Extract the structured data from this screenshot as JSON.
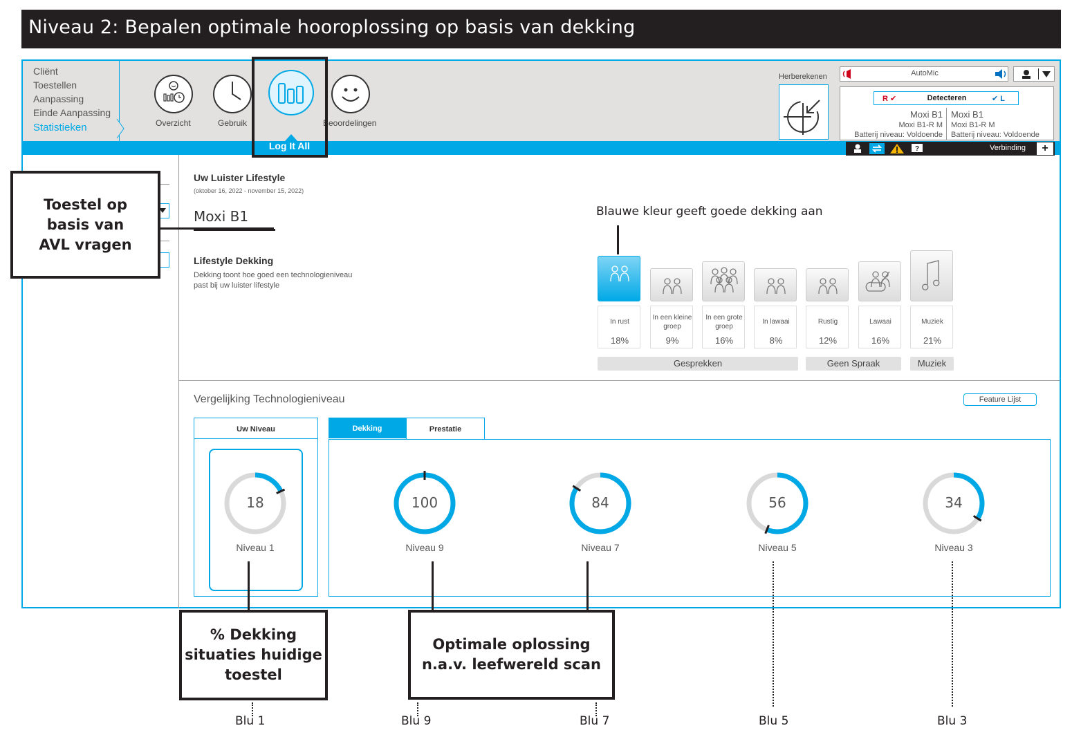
{
  "banner": {
    "title": "Niveau 2: Bepalen optimale hooroplossing op basis van dekking"
  },
  "nav": {
    "items": [
      "Cliënt",
      "Toestellen",
      "Aanpassing",
      "Einde Aanpassing"
    ],
    "active": "Statistieken"
  },
  "toolbar": {
    "overzicht": "Overzicht",
    "gebruik": "Gebruik",
    "beoordelingen": "Beoordelingen",
    "log_it_all": "Log It All",
    "herberekenen": "Herberekenen"
  },
  "device_panel": {
    "automic": "AutoMic",
    "detecteren": "Detecteren",
    "right_marker": "R ✔",
    "left_marker": "✔ L",
    "left_device": {
      "name": "Moxi B1",
      "model": "Moxi B1-R M",
      "battery": "Batterij niveau: Voldoende"
    },
    "right_device": {
      "name": "Moxi B1",
      "model": "Moxi B1-R M",
      "battery": "Batterij niveau: Voldoende"
    },
    "verbinding": "Verbinding",
    "plus": "+"
  },
  "lifestyle": {
    "title": "Uw Luister Lifestyle",
    "period": "(oktober 16, 2022 - november 15, 2022)",
    "device": "Moxi B1",
    "coverage_title": "Lifestyle Dekking",
    "coverage_desc_1": "Dekking toont hoe goed een technologieniveau",
    "coverage_desc_2": "past bij uw luister lifestyle",
    "situations": [
      {
        "name_1": "In rust",
        "name_2": "",
        "pct": "18%",
        "icon": "two-people-icon",
        "active": true
      },
      {
        "name_1": "In een kleine",
        "name_2": "groep",
        "pct": "9%",
        "icon": "small-group-icon",
        "active": false
      },
      {
        "name_1": "In een grote",
        "name_2": "groep",
        "pct": "16%",
        "icon": "large-group-icon",
        "active": false
      },
      {
        "name_1": "In lawaai",
        "name_2": "",
        "pct": "8%",
        "icon": "noisy-people-icon",
        "active": false
      },
      {
        "name_1": "Rustig",
        "name_2": "",
        "pct": "12%",
        "icon": "person-reading-icon",
        "active": false
      },
      {
        "name_1": "Lawaai",
        "name_2": "",
        "pct": "16%",
        "icon": "vacuum-cleaner-icon",
        "active": false
      },
      {
        "name_1": "Muziek",
        "name_2": "",
        "pct": "21%",
        "icon": "music-note-icon",
        "active": false
      }
    ],
    "groups": [
      "Gesprekken",
      "Geen Spraak",
      "Muziek"
    ]
  },
  "comparison": {
    "title": "Vergelijking Technologieniveau",
    "feature_button": "Feature Lijst",
    "uw_niveau": "Uw Niveau",
    "tab_dekking": "Dekking",
    "tab_prestatie": "Prestatie",
    "current": {
      "value": "18",
      "level": "Niveau 1",
      "coverage": 18
    },
    "levels": [
      {
        "value": "100",
        "level": "Niveau 9",
        "coverage": 100
      },
      {
        "value": "84",
        "level": "Niveau 7",
        "coverage": 84
      },
      {
        "value": "56",
        "level": "Niveau 5",
        "coverage": 56
      },
      {
        "value": "34",
        "level": "Niveau 3",
        "coverage": 34
      }
    ]
  },
  "annotations": {
    "toestel_callout": [
      "Toestel op",
      "basis van",
      "AVL vragen"
    ],
    "blue_note": "Blauwe kleur geeft goede dekking aan",
    "dekking_callout": [
      "% Dekking",
      "situaties huidige",
      "toestel"
    ],
    "optimale_callout": [
      "Optimale oplossing",
      "n.a.v. leefwereld scan"
    ],
    "blu_labels": [
      "Blu 1",
      "Blu 9",
      "Blu 7",
      "Blu 5",
      "Blu 3"
    ]
  },
  "colors": {
    "accent": "#00a9e6",
    "banner": "#231f20",
    "gauge_track": "#d9d9d9"
  }
}
